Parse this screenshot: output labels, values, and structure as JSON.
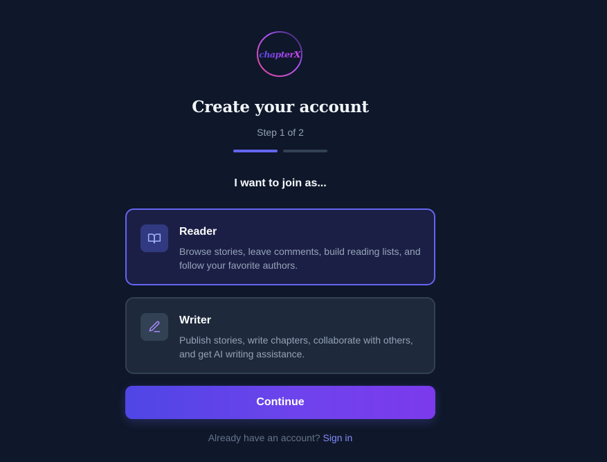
{
  "brand": {
    "logo_text": "chapterX",
    "colors": {
      "ring_start": "#ec4899",
      "ring_end": "#6366f1",
      "text_start": "#6366f1",
      "text_end": "#d946ef"
    }
  },
  "header": {
    "title": "Create your account",
    "step_text": "Step 1 of 2",
    "progress": {
      "current_step": 1,
      "total_steps": 2
    }
  },
  "role_selection": {
    "prompt": "I want to join as...",
    "options": [
      {
        "title": "Reader",
        "description": "Browse stories, leave comments, build reading lists, and follow your favorite authors.",
        "icon": "book-open-icon",
        "selected": true
      },
      {
        "title": "Writer",
        "description": "Publish stories, write chapters, collaborate with others, and get AI writing assistance.",
        "icon": "pen-icon",
        "selected": false
      }
    ]
  },
  "actions": {
    "continue_label": "Continue"
  },
  "footer": {
    "prompt": "Already have an account?",
    "link_label": "Sign in"
  },
  "theme": {
    "background": "#0f172a",
    "accent": "#6366f1",
    "link": "#818cf8"
  }
}
